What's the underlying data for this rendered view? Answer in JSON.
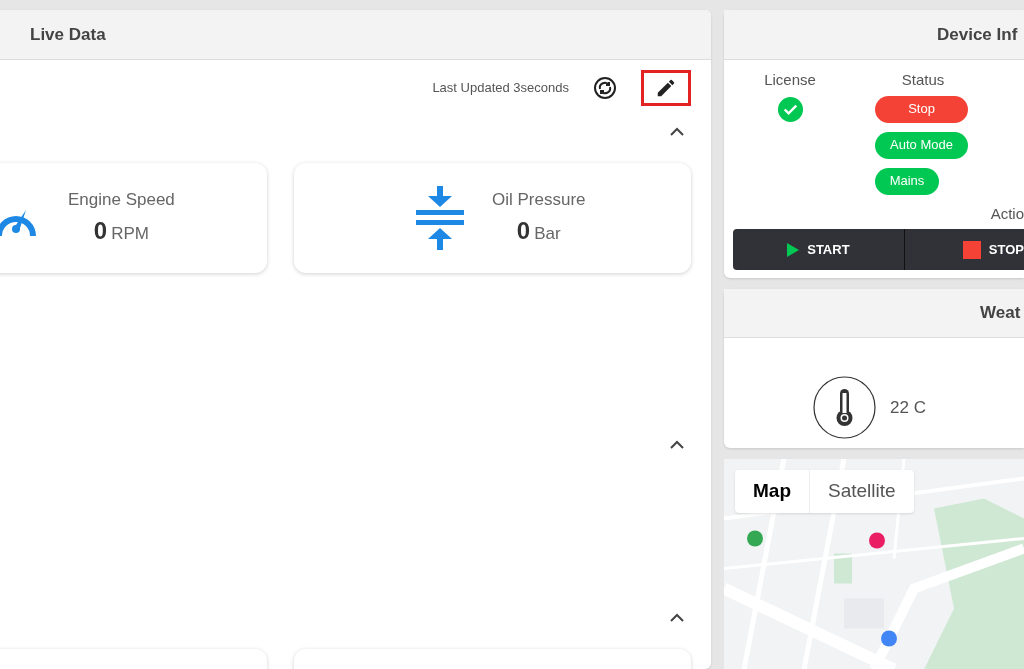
{
  "live_data": {
    "title": "Live Data",
    "last_updated": "Last Updated 3seconds",
    "edit_highlighted": true,
    "sections": [
      {
        "expanded": true,
        "cards": [
          {
            "kind": "gauge",
            "label": "Engine Speed",
            "value": "0",
            "unit": "RPM"
          },
          {
            "kind": "pressure",
            "label": "Oil Pressure",
            "value": "0",
            "unit": "Bar"
          }
        ]
      },
      {
        "expanded": true
      },
      {
        "expanded": true,
        "cards": [
          {
            "kind": "blank"
          },
          {
            "kind": "blank"
          }
        ]
      }
    ]
  },
  "device_info": {
    "title": "Device Inf",
    "license": {
      "label": "License",
      "valid": true
    },
    "status": {
      "label": "Status",
      "badges": [
        {
          "text": "Stop",
          "color": "#f44336"
        },
        {
          "text": "Auto Mode",
          "color": "#00c853"
        },
        {
          "text": "Mains",
          "color": "#00c853"
        }
      ]
    },
    "action_label": "Actio",
    "buttons": [
      {
        "kind": "start",
        "label": "START"
      },
      {
        "kind": "stop",
        "label": "STOP"
      }
    ]
  },
  "weather": {
    "title": "Weat",
    "temperature": "22 C"
  },
  "map": {
    "type_buttons": [
      {
        "label": "Map",
        "selected": true
      },
      {
        "label": "Satellite",
        "selected": false
      }
    ]
  }
}
